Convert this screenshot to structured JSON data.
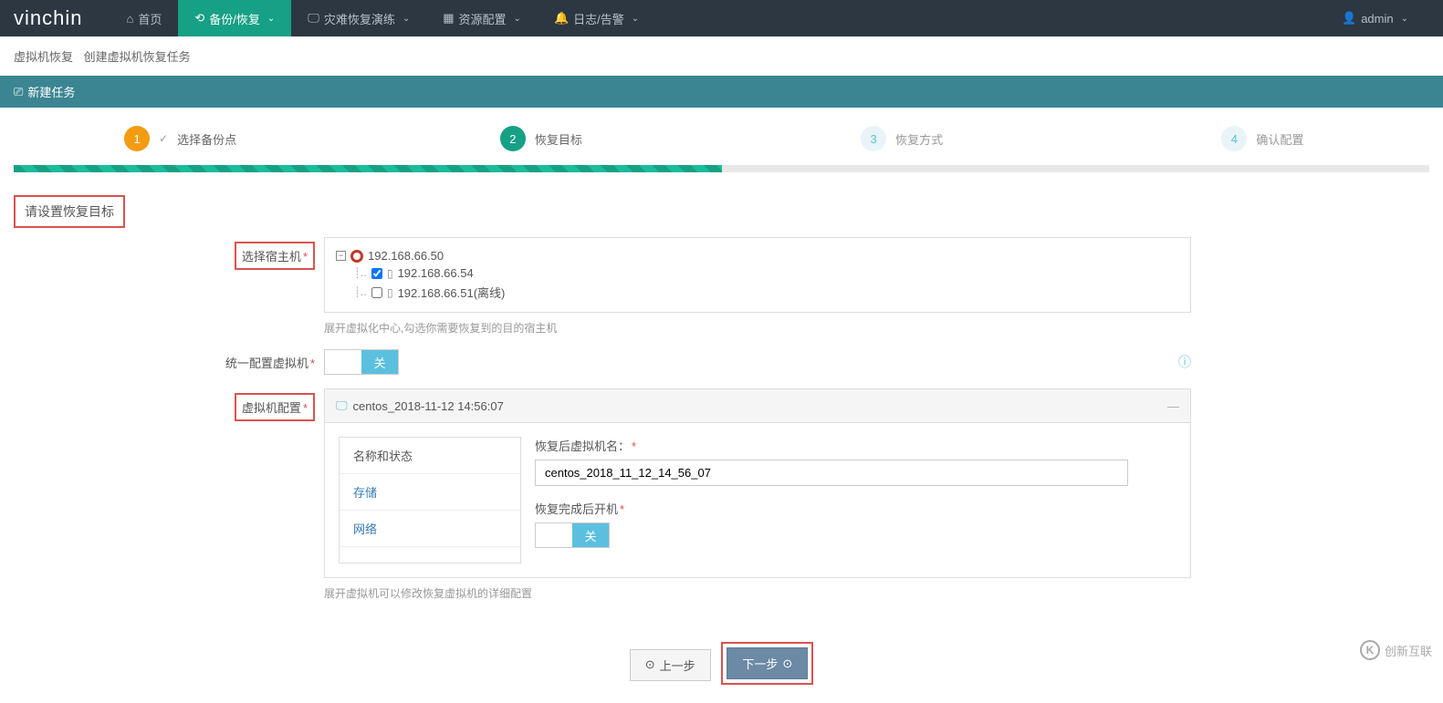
{
  "brand": "vinchin",
  "nav": {
    "home": "首页",
    "backup": "备份/恢复",
    "drill": "灾难恢复演练",
    "resource": "资源配置",
    "log": "日志/告警",
    "user": "admin"
  },
  "breadcrumb": {
    "main": "虚拟机恢复",
    "sub": "创建虚拟机恢复任务"
  },
  "panel_title": "新建任务",
  "steps": [
    {
      "num": "1",
      "label": "选择备份点"
    },
    {
      "num": "2",
      "label": "恢复目标"
    },
    {
      "num": "3",
      "label": "恢复方式"
    },
    {
      "num": "4",
      "label": "确认配置"
    }
  ],
  "section_title": "请设置恢复目标",
  "host": {
    "label": "选择宿主机",
    "root": "192.168.66.50",
    "children": [
      {
        "ip": "192.168.66.54",
        "checked": true
      },
      {
        "ip": "192.168.66.51(离线)",
        "checked": false
      }
    ],
    "hint": "展开虚拟化中心,勾选你需要恢复到的目的宿主机"
  },
  "unified": {
    "label": "统一配置虚拟机",
    "off_text": "关"
  },
  "vmconfig": {
    "label": "虚拟机配置",
    "vm_name": "centos_2018-11-12 14:56:07",
    "tabs": {
      "name_status": "名称和状态",
      "storage": "存储",
      "network": "网络"
    },
    "name_label": "恢复后虚拟机名：",
    "name_value": "centos_2018_11_12_14_56_07",
    "boot_label": "恢复完成后开机",
    "boot_off": "关",
    "hint": "展开虚拟机可以修改恢复虚拟机的详细配置"
  },
  "buttons": {
    "prev": "上一步",
    "next": "下一步"
  },
  "watermark": "创新互联"
}
